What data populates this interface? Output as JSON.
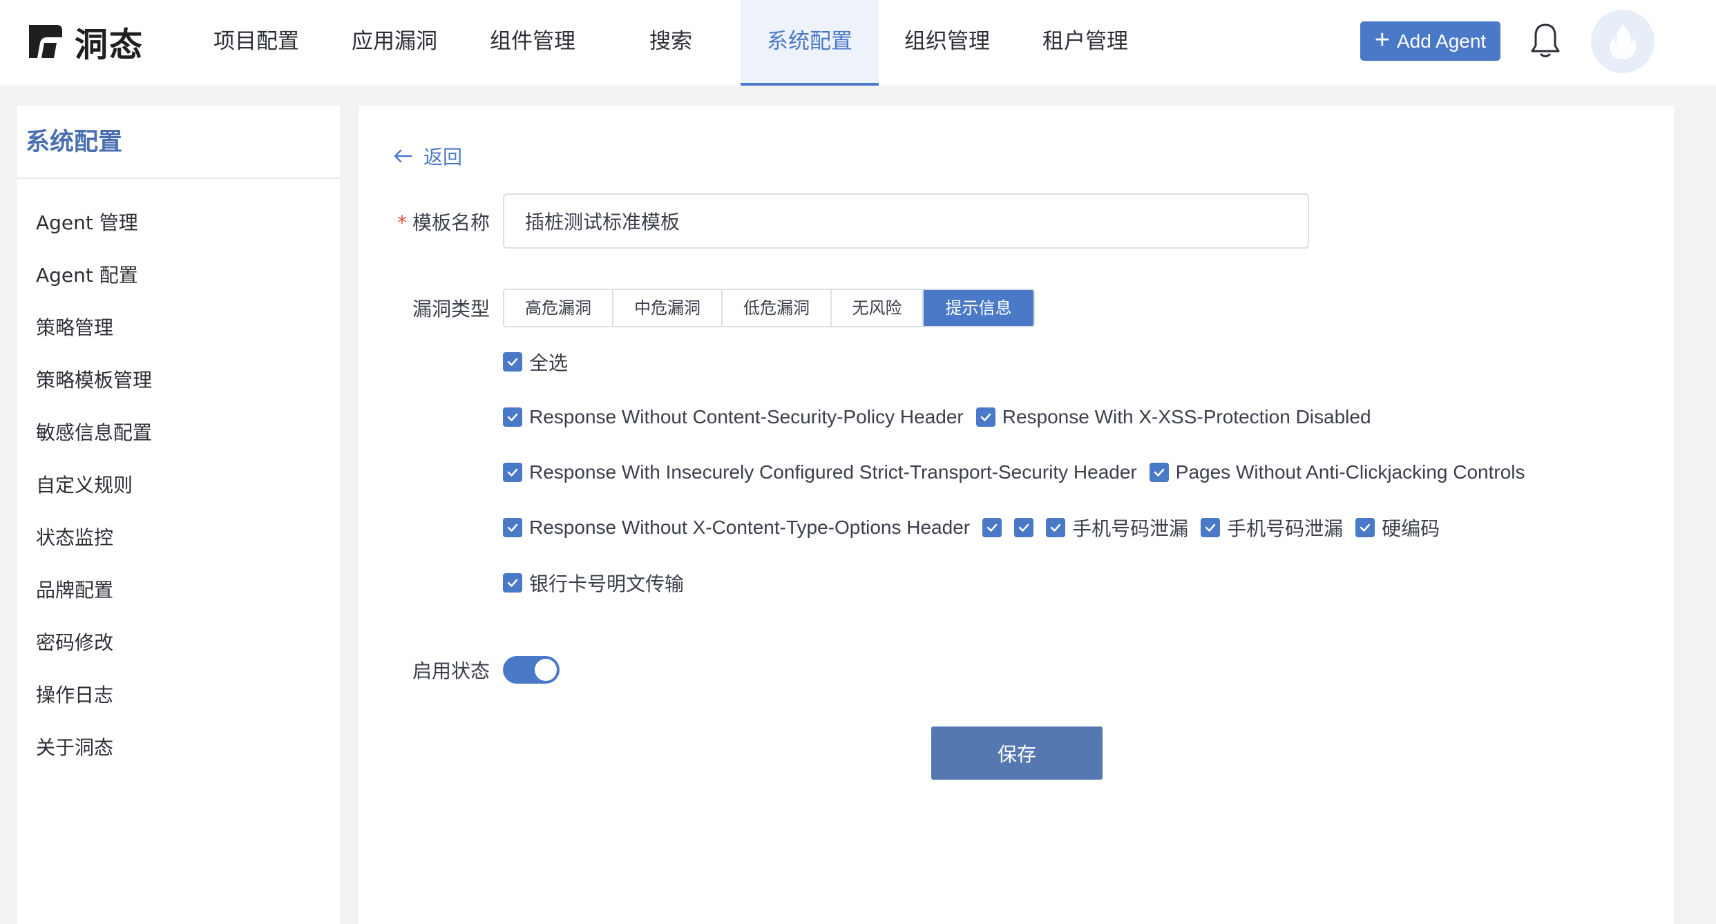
{
  "brand": {
    "name": "洞态",
    "accent": "#4a79c8",
    "danger": "#e5533d"
  },
  "nav": {
    "items": [
      {
        "label": "项目配置"
      },
      {
        "label": "应用漏洞"
      },
      {
        "label": "组件管理"
      },
      {
        "label": "搜索"
      },
      {
        "label": "系统配置",
        "active": true
      },
      {
        "label": "组织管理"
      },
      {
        "label": "租户管理"
      }
    ],
    "add_agent_label": "Add Agent",
    "icons": [
      "plus-icon",
      "bell-icon",
      "avatar-flame-icon"
    ]
  },
  "sidebar": {
    "title": "系统配置",
    "items": [
      {
        "label": "Agent 管理"
      },
      {
        "label": "Agent 配置"
      },
      {
        "label": "策略管理"
      },
      {
        "label": "策略模板管理"
      },
      {
        "label": "敏感信息配置"
      },
      {
        "label": "自定义规则"
      },
      {
        "label": "状态监控"
      },
      {
        "label": "品牌配置"
      },
      {
        "label": "密码修改"
      },
      {
        "label": "操作日志"
      },
      {
        "label": "关于洞态"
      }
    ]
  },
  "form": {
    "back_label": "返回",
    "required_mark": "*",
    "template_name_label": "模板名称",
    "template_name_value": "插桩测试标准模板",
    "vuln_type_label": "漏洞类型",
    "vuln_types": [
      {
        "label": "高危漏洞"
      },
      {
        "label": "中危漏洞"
      },
      {
        "label": "低危漏洞"
      },
      {
        "label": "无风险"
      },
      {
        "label": "提示信息",
        "active": true
      }
    ],
    "select_all_label": "全选",
    "checkbox_rows": [
      [
        "Response Without Content-Security-Policy Header",
        "Response With X-XSS-Protection Disabled"
      ],
      [
        "Response With Insecurely Configured Strict-Transport-Security Header",
        "Pages Without Anti-Clickjacking Controls"
      ],
      [
        "Response Without X-Content-Type-Options Header",
        "",
        "",
        "手机号码泄漏",
        "手机号码泄漏",
        "硬编码"
      ],
      [
        "银行卡号明文传输"
      ]
    ],
    "enable_status_label": "启用状态",
    "enabled": true,
    "save_label": "保存"
  }
}
